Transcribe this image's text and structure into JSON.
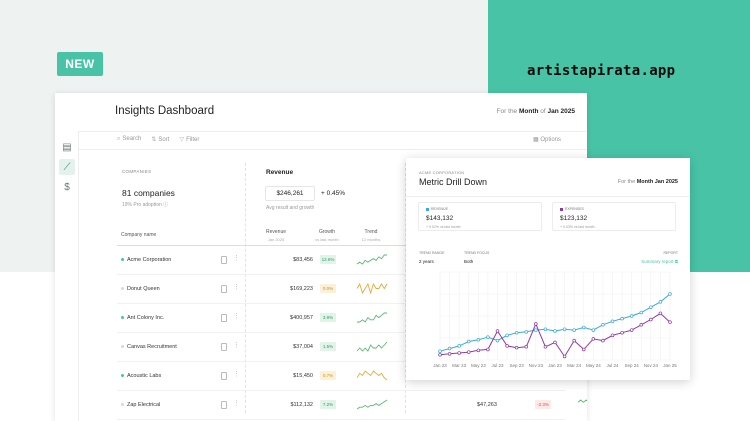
{
  "badge": "NEW",
  "watermark": "artistapirata.app",
  "main": {
    "title": "Insights Dashboard",
    "period_prefix": "For the",
    "period_unit": "Month",
    "period_of": "of",
    "period_value": "Jan 2025",
    "toolbar": {
      "search": "Search",
      "sort": "Sort",
      "filter": "Filter",
      "options": "Options"
    },
    "companies": {
      "label": "COMPANIES",
      "count": "81 companies",
      "pro": "19% Pro adoption"
    },
    "revenue": {
      "label": "Revenue",
      "value": "$246,261",
      "change": "+ 0.45%",
      "sub": "Avg result and growth"
    },
    "columns": {
      "company": "Company name",
      "revenue": "Revenue",
      "revenue_sub": "Jan 2025",
      "growth": "Growth",
      "growth_sub": "vs last month",
      "trend": "Trend",
      "trend_sub": "12 months"
    },
    "rows": [
      {
        "name": "Acme Corporation",
        "revenue": "$83,456",
        "growth": "12.6%",
        "growth_type": "pos",
        "trend": [
          3,
          4,
          3,
          5,
          4,
          5,
          6,
          5,
          7,
          6,
          8,
          8
        ]
      },
      {
        "name": "Donut Queen",
        "revenue": "$169,223",
        "growth": "0.0%",
        "growth_type": "neu",
        "trend": [
          5,
          6,
          4,
          5,
          6,
          4,
          6,
          5,
          5,
          6,
          5,
          6
        ]
      },
      {
        "name": "Ant Colony Inc.",
        "revenue": "$400,957",
        "growth": "3.9%",
        "growth_type": "pos",
        "trend": [
          3,
          3,
          4,
          3,
          5,
          4,
          4,
          6,
          5,
          6,
          7,
          7
        ]
      },
      {
        "name": "Canvas Recruitment",
        "revenue": "$37,004",
        "growth": "1.5%",
        "growth_type": "pos",
        "trend": [
          4,
          5,
          4,
          5,
          4,
          6,
          5,
          5,
          6,
          5,
          6,
          7
        ]
      },
      {
        "name": "Acoustic Labs",
        "revenue": "$15,450",
        "growth": "0.7%",
        "growth_type": "neu",
        "trend": [
          4,
          6,
          5,
          7,
          6,
          5,
          7,
          6,
          5,
          6,
          4,
          3
        ]
      },
      {
        "name": "Zap Electrical",
        "revenue": "$112,132",
        "growth": "7.2%",
        "growth_type": "pos",
        "trend": [
          3,
          4,
          4,
          5,
          4,
          5,
          5,
          6,
          5,
          6,
          7,
          8
        ],
        "extra_revenue": "$47,263",
        "extra_growth": "-2.3%",
        "extra_trend": [
          6,
          7,
          6,
          7,
          6,
          6,
          5,
          6,
          5,
          4,
          5,
          3
        ]
      }
    ]
  },
  "drill": {
    "label": "ACME CORPORATION",
    "title": "Metric Drill Down",
    "period_prefix": "For the",
    "period_unit": "Month",
    "period_value": "Jan 2025",
    "revenue": {
      "label": "REVENUE",
      "value": "$143,132",
      "change": "+ 0.02%",
      "change_sub": "vs last month",
      "color": "#3ba7e0"
    },
    "expenses": {
      "label": "EXPENSES",
      "value": "$123,132",
      "change": "+ 0.03%",
      "change_sub": "vs last month",
      "color": "#8e3a9e"
    },
    "trend_range_label": "TREND RANGE",
    "trend_range_value": "2 years",
    "trend_focus_label": "TREND FOCUS",
    "trend_focus_value": "Both",
    "report_label": "REPORT",
    "report_link": "Summary report"
  },
  "chart_data": {
    "type": "line",
    "x": [
      "Jan 23",
      "Feb 23",
      "Mar 23",
      "Apr 23",
      "May 23",
      "Jun 23",
      "Jul 23",
      "Aug 23",
      "Sep 23",
      "Oct 23",
      "Nov 23",
      "Dec 23",
      "Jan 24",
      "Feb 24",
      "Mar 24",
      "Apr 24",
      "May 24",
      "Jun 24",
      "Jul 24",
      "Aug 24",
      "Sep 24",
      "Oct 24",
      "Nov 24",
      "Dec 24",
      "Jan 25"
    ],
    "x_tick_labels": [
      "Jan 23",
      "Mar 23",
      "May 23",
      "Jul 23",
      "Sep 23",
      "Nov 23",
      "Jan 23",
      "Mar 24",
      "May 24",
      "Jul 24",
      "Sep 24",
      "Nov 24",
      "Jan 25"
    ],
    "series": [
      {
        "name": "REVENUE",
        "color": "#3ba7e0",
        "values": [
          10,
          13,
          16,
          21,
          23,
          26,
          22,
          28,
          31,
          32,
          34,
          35,
          33,
          35,
          34,
          37,
          34,
          40,
          44,
          47,
          50,
          54,
          60,
          66,
          75
        ]
      },
      {
        "name": "EXPENSES",
        "color": "#8e3a9e",
        "values": [
          6,
          7,
          8,
          9,
          11,
          12,
          33,
          16,
          14,
          15,
          41,
          15,
          20,
          4,
          22,
          12,
          24,
          22,
          28,
          31,
          34,
          40,
          46,
          53,
          43
        ]
      }
    ],
    "ylim": [
      0,
      100
    ],
    "grid": true
  }
}
